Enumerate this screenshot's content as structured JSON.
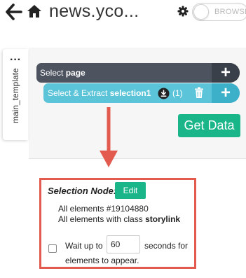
{
  "header": {
    "site_title": "news.yco...",
    "toggle_label": "BROWSE",
    "icons": [
      "back-arrow-icon",
      "home-icon",
      "gear-icon"
    ]
  },
  "sidetab": {
    "label": "main_template",
    "menu_icon": "more-dots-icon"
  },
  "commands": {
    "select_page": {
      "prefix": "Select",
      "name": "page"
    },
    "select_extract": {
      "prefix": "Select & Extract",
      "name": "selection1",
      "count": "(1)"
    },
    "plus_label": "+"
  },
  "get_data_label": "Get Data",
  "selection_node": {
    "title": "Selection Node:",
    "edit_label": "Edit",
    "line1": "All elements #19104880",
    "line2_prefix": "All elements with class",
    "line2_class": "storylink",
    "wait_prefix": "Wait up to",
    "wait_value": "60",
    "wait_suffix": "seconds for",
    "wait_line2": "elements to appear."
  },
  "colors": {
    "dark_command": "#4d5460",
    "extract_command": "#5bc4d8",
    "green_button": "#1bb58a",
    "highlight_red": "#e35a4e"
  }
}
